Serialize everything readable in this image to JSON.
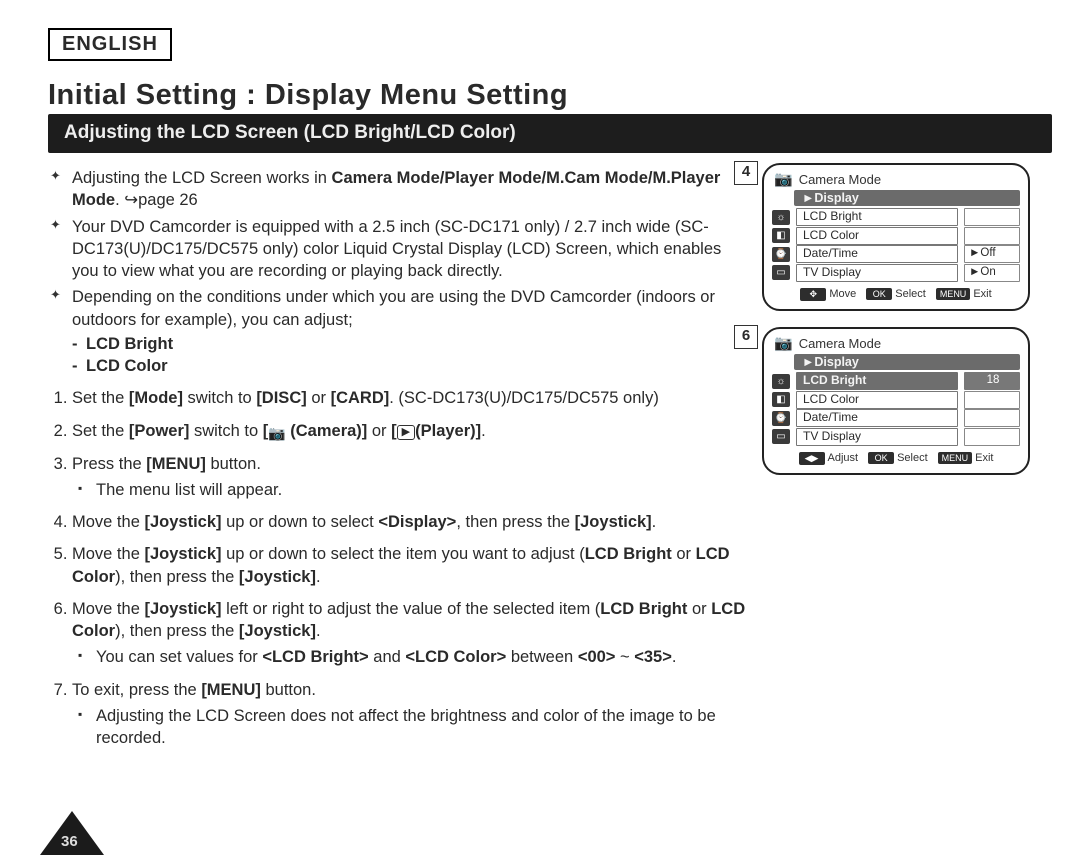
{
  "page_number": "36",
  "language_box": "ENGLISH",
  "page_title": "Initial Setting : Display Menu Setting",
  "section_bar": "Adjusting the LCD Screen (LCD Bright/LCD Color)",
  "intro": {
    "d1_a": "Adjusting the LCD Screen works in ",
    "d1_b": "Camera Mode/Player Mode/M.Cam Mode/M.Player Mode",
    "d1_c": ". ↪page 26",
    "d2": "Your DVD Camcorder is equipped with a 2.5 inch (SC-DC171 only) / 2.7 inch wide (SC-DC173(U)/DC175/DC575 only) color Liquid Crystal Display (LCD) Screen, which enables you to view what you are recording or playing back directly.",
    "d3": "Depending on the conditions under which you are using the DVD Camcorder (indoors or outdoors for example), you can adjust;",
    "dash1": "LCD Bright",
    "dash2": "LCD Color"
  },
  "steps": {
    "s1_a": "Set the ",
    "s1_b": "[Mode]",
    "s1_c": " switch to ",
    "s1_d": "[DISC]",
    "s1_e": " or ",
    "s1_f": "[CARD]",
    "s1_g": ". (SC-DC173(U)/DC175/DC575 only)",
    "s2_a": "Set the ",
    "s2_b": "[Power]",
    "s2_c": " switch to ",
    "s2_d": "[",
    "s2_cam": " (Camera)]",
    "s2_e": " or ",
    "s2_f": "[",
    "s2_play": "(Player)]",
    "s2_g": ".",
    "s3_a": "Press the ",
    "s3_b": "[MENU]",
    "s3_c": " button.",
    "s3_sub": "The menu list will appear.",
    "s4_a": "Move the ",
    "s4_b": "[Joystick]",
    "s4_c": " up or down to select ",
    "s4_d": "<Display>",
    "s4_e": ", then press the ",
    "s4_f": "[Joystick]",
    "s4_g": ".",
    "s5_a": "Move the ",
    "s5_b": "[Joystick]",
    "s5_c": " up or down to select the item you want to adjust (",
    "s5_d": "LCD Bright",
    "s5_e": " or ",
    "s5_f": "LCD Color",
    "s5_g": "), then press the ",
    "s5_h": "[Joystick]",
    "s5_i": ".",
    "s6_a": "Move the ",
    "s6_b": "[Joystick]",
    "s6_c": " left or right to adjust the value of the selected item (",
    "s6_d": "LCD Bright",
    "s6_e": " or ",
    "s6_f": "LCD Color",
    "s6_g": "), then press the ",
    "s6_h": "[Joystick]",
    "s6_i": ".",
    "s6_sub_a": "You can set values for ",
    "s6_sub_b": "<LCD Bright>",
    "s6_sub_c": " and ",
    "s6_sub_d": "<LCD Color>",
    "s6_sub_e": " between ",
    "s6_sub_f": "<00>",
    "s6_sub_g": " ~ ",
    "s6_sub_h": "<35>",
    "s6_sub_i": ".",
    "s7_a": "To exit, press the ",
    "s7_b": "[MENU]",
    "s7_c": " button.",
    "s7_sub": "Adjusting the LCD Screen does not affect the brightness and color of the image to be recorded."
  },
  "panels": {
    "p4": {
      "step": "4",
      "mode": "Camera Mode",
      "section": "►Display",
      "rows": [
        {
          "label": "LCD Bright",
          "val": ""
        },
        {
          "label": "LCD Color",
          "val": ""
        },
        {
          "label": "Date/Time",
          "val": "►Off"
        },
        {
          "label": "TV Display",
          "val": "►On"
        }
      ],
      "foot": [
        {
          "key": "✥",
          "txt": "Move"
        },
        {
          "key": "OK",
          "txt": "Select"
        },
        {
          "key": "MENU",
          "txt": "Exit"
        }
      ]
    },
    "p6": {
      "step": "6",
      "mode": "Camera Mode",
      "section": "►Display",
      "rows": [
        {
          "label": "LCD Bright",
          "val": "18",
          "selected": true
        },
        {
          "label": "LCD Color",
          "val": ""
        },
        {
          "label": "Date/Time",
          "val": ""
        },
        {
          "label": "TV Display",
          "val": ""
        }
      ],
      "foot": [
        {
          "key": "◀▶",
          "txt": "Adjust"
        },
        {
          "key": "OK",
          "txt": "Select"
        },
        {
          "key": "MENU",
          "txt": "Exit"
        }
      ]
    }
  }
}
